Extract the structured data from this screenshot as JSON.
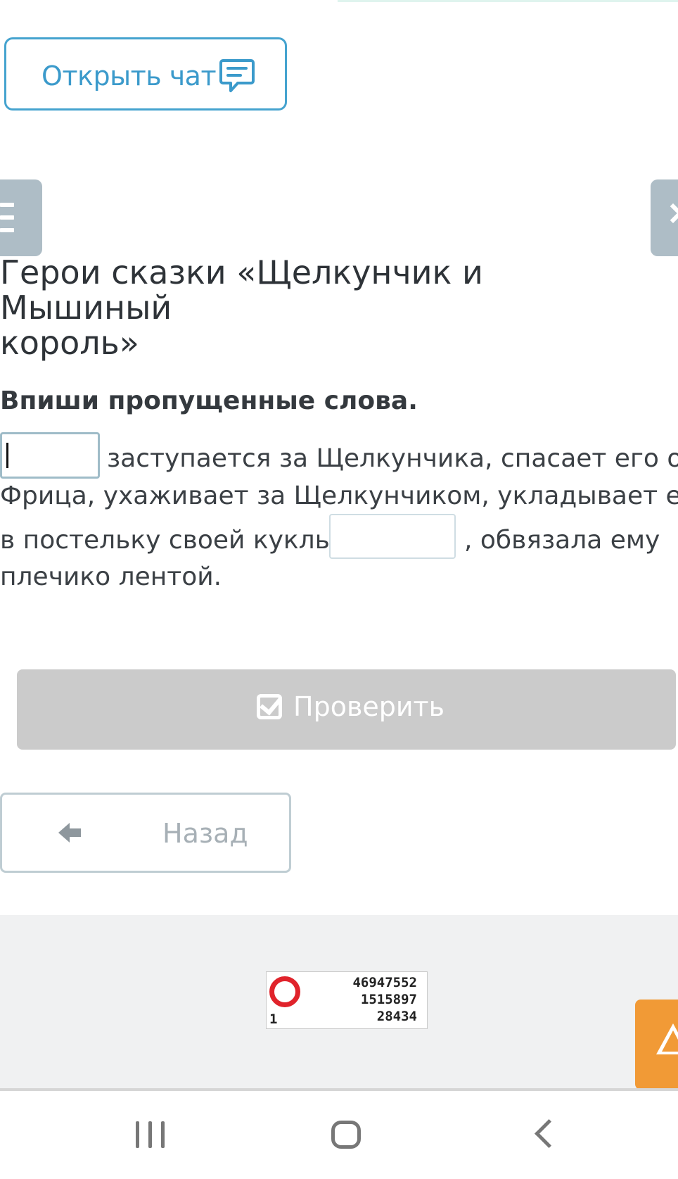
{
  "chat": {
    "label": "Открыть чат",
    "icon": "chat-bubble-icon",
    "color": "#3b9acb"
  },
  "sidebar": {
    "menu_icon": "hamburger-menu-icon",
    "next_icon": "chevron-right-icon"
  },
  "lesson": {
    "title_line1": "Герои сказки «Щелкунчик и Мышиный",
    "title_line2": "король»"
  },
  "task": {
    "instruction": "Впиши пропущенные слова.",
    "text_1": "заступается за Щелкунчика, спасает его от",
    "text_2": "Фрица, ухаживает за Щелкунчиком, укладывает его",
    "text_3": "в постельку своей куклы",
    "text_4": ", обвязала ему",
    "text_5": "плечико лентой.",
    "gap_1_value": "",
    "gap_2_value": ""
  },
  "actions": {
    "check_label": "Проверить",
    "check_icon": "checkbox-checked-icon",
    "back_label": "Назад",
    "back_icon": "arrow-left-icon"
  },
  "counter": {
    "line_1": "46947552",
    "line_2": "1515897",
    "line_3": "28434",
    "corner": "1"
  },
  "report": {
    "icon": "warning-triangle-icon",
    "color": "#f19a36"
  },
  "system_nav": {
    "recent_icon": "recent-apps-icon",
    "home_icon": "home-icon",
    "back_icon": "back-chevron-icon"
  }
}
